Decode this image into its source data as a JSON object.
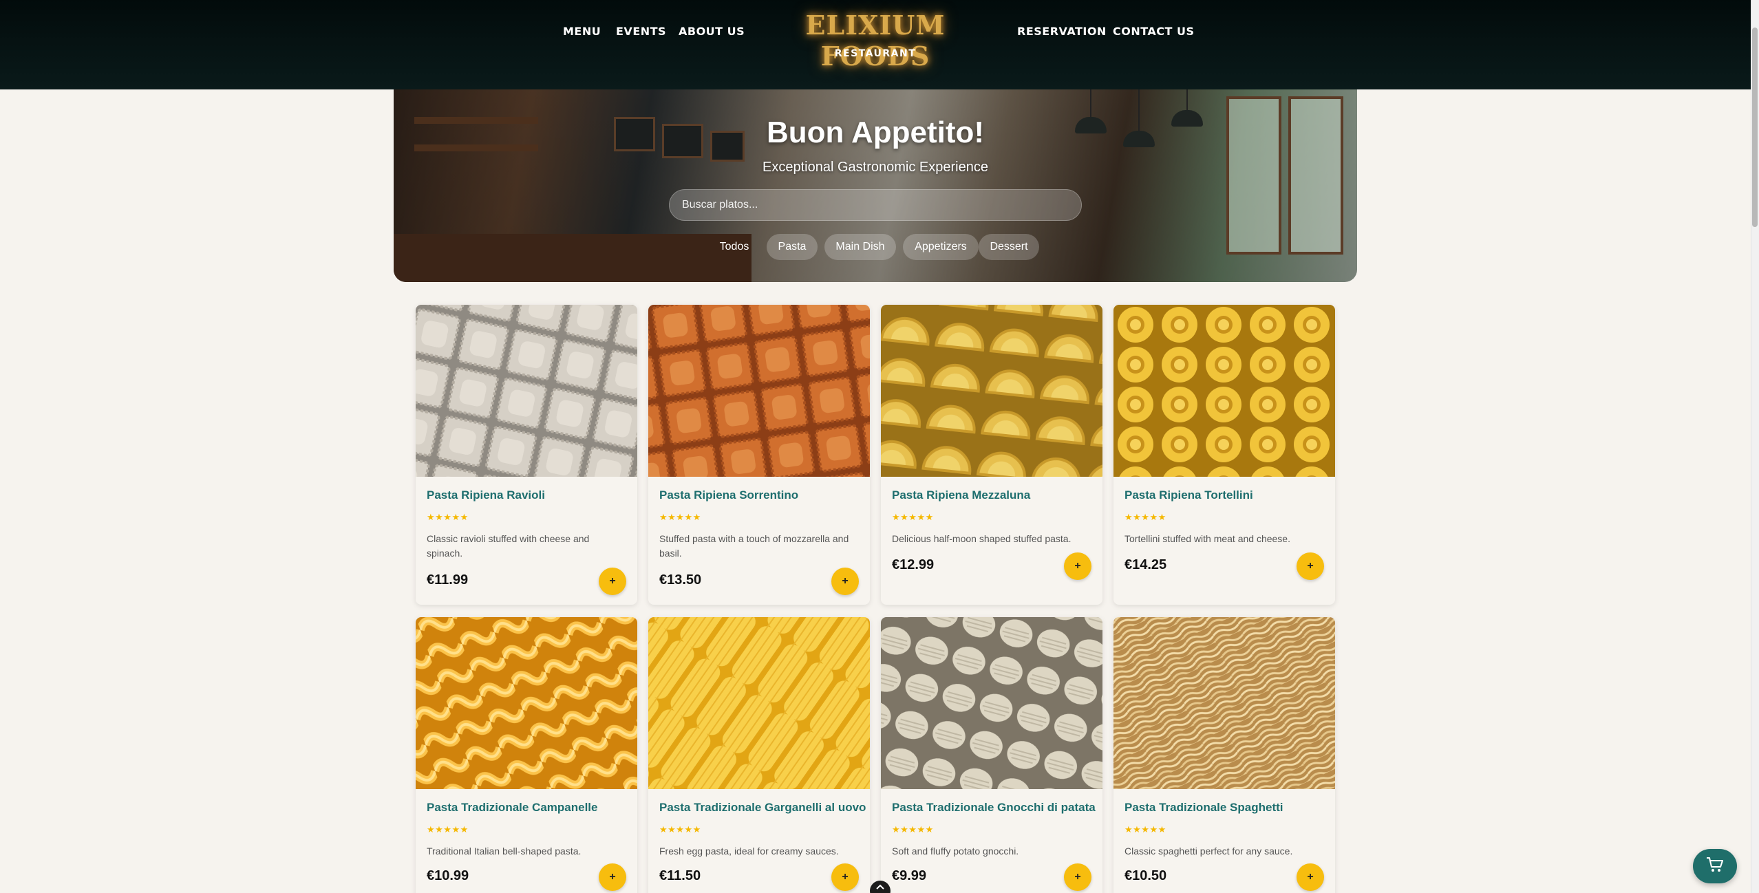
{
  "header": {
    "nav_left": [
      "MENU",
      "EVENTS",
      "ABOUT US"
    ],
    "logo": "ELIXIUM FOODS",
    "logo_sub": "RESTAURANT",
    "nav_right": [
      "RESERVATION",
      "CONTACT US"
    ]
  },
  "hero": {
    "title": "Buon Appetito!",
    "subtitle": "Exceptional Gastronomic Experience",
    "search_placeholder": "Buscar platos...",
    "filters": [
      "Todos",
      "Pasta",
      "Main Dish",
      "Appetizers",
      "Dessert"
    ],
    "active_filter": "Todos"
  },
  "dishes": [
    {
      "name": "Pasta Ripiena Ravioli",
      "rating": 5,
      "stars": "★★★★★",
      "desc": "Classic ravioli stuffed with cheese and spinach.",
      "price": "€11.99"
    },
    {
      "name": "Pasta Ripiena Sorrentino",
      "rating": 5,
      "stars": "★★★★★",
      "desc": "Stuffed pasta with a touch of mozzarella and basil.",
      "price": "€13.50"
    },
    {
      "name": "Pasta Ripiena Mezzaluna",
      "rating": 5,
      "stars": "★★★★★",
      "desc": "Delicious half-moon shaped stuffed pasta.",
      "price": "€12.99"
    },
    {
      "name": "Pasta Ripiena Tortellini",
      "rating": 5,
      "stars": "★★★★★",
      "desc": "Tortellini stuffed with meat and cheese.",
      "price": "€14.25"
    },
    {
      "name": "Pasta Tradizionale Campanelle",
      "rating": 5,
      "stars": "★★★★★",
      "desc": "Traditional Italian bell-shaped pasta.",
      "price": "€10.99"
    },
    {
      "name": "Pasta Tradizionale Garganelli al uovo",
      "rating": 5,
      "stars": "★★★★★",
      "desc": "Fresh egg pasta, ideal for creamy sauces.",
      "price": "€11.50"
    },
    {
      "name": "Pasta Tradizionale Gnocchi di patata",
      "rating": 5,
      "stars": "★★★★★",
      "desc": "Soft and fluffy potato gnocchi.",
      "price": "€9.99"
    },
    {
      "name": "Pasta Tradizionale Spaghetti",
      "rating": 5,
      "stars": "★★★★★",
      "desc": "Classic spaghetti perfect for any sauce.",
      "price": "€10.50"
    }
  ],
  "add_label": "+",
  "icons": {
    "cart": "shopping-cart-icon",
    "scroll_top": "chevron-up-icon",
    "add": "plus-icon"
  },
  "colors": {
    "header_bg": "#020b0b",
    "logo_gold": "#d9a94b",
    "title_teal": "#1e6e6e",
    "star_yellow": "#f5b800",
    "add_button": "#f7bd0e",
    "cart_button": "#1f6e6a",
    "page_bg": "#f6f3ee"
  }
}
